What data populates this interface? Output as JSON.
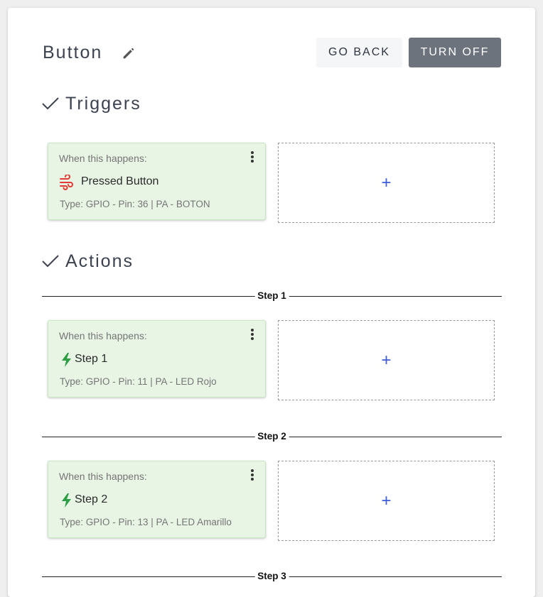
{
  "header": {
    "title": "Button",
    "go_back_label": "GO BACK",
    "turn_off_label": "TURN OFF"
  },
  "triggers": {
    "title": "Triggers",
    "cards": [
      {
        "caption": "When this happens:",
        "name": "Pressed Button",
        "meta": "Type: GPIO - Pin: 36 | PA - BOTON",
        "icon": "wind-icon",
        "icon_color": "#e53935"
      }
    ],
    "add_label": "+"
  },
  "actions": {
    "title": "Actions",
    "steps": [
      {
        "label": "Step 1",
        "card": {
          "caption": "When this happens:",
          "name": "Step 1",
          "meta": "Type: GPIO - Pin: 11 | PA - LED Rojo",
          "icon": "lightning-bolt-icon",
          "icon_color": "#2e9e44"
        },
        "add_label": "+"
      },
      {
        "label": "Step 2",
        "card": {
          "caption": "When this happens:",
          "name": "Step 2",
          "meta": "Type: GPIO - Pin: 13 | PA - LED Amarillo",
          "icon": "lightning-bolt-icon",
          "icon_color": "#2e9e44"
        },
        "add_label": "+"
      },
      {
        "label": "Step 3"
      }
    ]
  },
  "colors": {
    "card_bg": "#e8f5e5",
    "accent_plus": "#3b5bdb",
    "turn_off_bg": "#6c737d"
  }
}
